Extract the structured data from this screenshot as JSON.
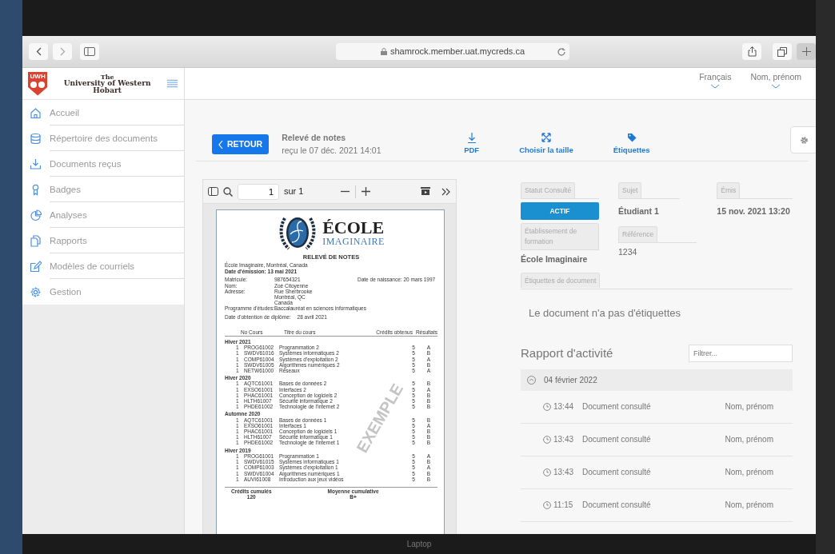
{
  "browser": {
    "url": "shamrock.member.uat.mycreds.ca"
  },
  "logo": {
    "badge": "UWH",
    "line_1": "The",
    "line_2": "University of Western Hobart"
  },
  "sidebar": {
    "items": [
      {
        "label": "Accueil"
      },
      {
        "label": "Répertoire des documents"
      },
      {
        "label": "Documents reçus"
      },
      {
        "label": "Badges"
      },
      {
        "label": "Analyses"
      },
      {
        "label": "Rapports"
      },
      {
        "label": "Modèles de courriels"
      },
      {
        "label": "Gestion"
      }
    ]
  },
  "header": {
    "language": "Français",
    "user": "Nom, prénom"
  },
  "toolbar": {
    "back": "RETOUR",
    "title": "Relevé de notes",
    "received": "reçu le 07 déc. 2021 14:01",
    "actions": [
      {
        "label": "PDF"
      },
      {
        "label": "Choisir la taille"
      },
      {
        "label": "Étiquettes"
      }
    ]
  },
  "viewer": {
    "page": "1",
    "page_total": "sur 1"
  },
  "document": {
    "school_1": "ÉCOLE",
    "school_2": "IMAGINAIRE",
    "title": "RELEVÉ DE NOTES",
    "place": "École Imaginaire, Montréal, Canada",
    "issued": "Date d'émission: 13 mai 2021",
    "info": [
      {
        "label": "Matricule:",
        "value": "987654321"
      },
      {
        "label": "Nom:",
        "value": "Zoé Citoyenne"
      },
      {
        "label": "Adresse:",
        "value": "Rue Sherbrooke"
      },
      {
        "value": "Montréal, QC"
      },
      {
        "value": "Canada"
      },
      {
        "label": "Programme d'études:",
        "value": "Baccalauréat en sciences informatiques"
      }
    ],
    "birth": "Date de naissance: 20 mars 1997",
    "graduation_label": "Date d'obtention de diplôme:",
    "graduation": "28 avril 2021",
    "columns": [
      "No Cours",
      "Titre du cours",
      "Crédits obtenus",
      "Résultats"
    ],
    "terms": [
      {
        "name": "Hiver 2021",
        "rows": [
          [
            "1",
            "PROG61002",
            "Programmation 2",
            "5",
            "A"
          ],
          [
            "1",
            "SWDV61016",
            "Systèmes informatiques 2",
            "5",
            "B"
          ],
          [
            "1",
            "COMP61004",
            "Systèmes d'exploitation 2",
            "5",
            "A"
          ],
          [
            "1",
            "SWDV61005",
            "Algorithmes numériques 2",
            "5",
            "B"
          ],
          [
            "1",
            "NETW61000",
            "Réseaux",
            "5",
            "A"
          ]
        ]
      },
      {
        "name": "Hiver 2020",
        "rows": [
          [
            "1",
            "AQTC61001",
            "Bases de données 2",
            "5",
            "B"
          ],
          [
            "1",
            "EXSO61001",
            "Interfaces 2",
            "5",
            "A"
          ],
          [
            "1",
            "PHAC61001",
            "Conception de logiciels 2",
            "5",
            "B"
          ],
          [
            "1",
            "HLTH61007",
            "Sécurité informatique 2",
            "5",
            "B"
          ],
          [
            "1",
            "PHDE61002",
            "Technologie de l'internet 2",
            "5",
            "B"
          ]
        ]
      },
      {
        "name": "Automne 2020",
        "rows": [
          [
            "1",
            "AQTC61001",
            "Bases de données 1",
            "5",
            "B"
          ],
          [
            "1",
            "EXSO61001",
            "Interfaces 1",
            "5",
            "A"
          ],
          [
            "1",
            "PHAC61001",
            "Conception de logiciels 1",
            "5",
            "B"
          ],
          [
            "1",
            "HLTH61007",
            "Sécurité informatique 1",
            "5",
            "B"
          ],
          [
            "1",
            "PHDE61002",
            "Technologie de l'internet 1",
            "5",
            "B"
          ]
        ]
      },
      {
        "name": "Hiver 2019",
        "rows": [
          [
            "1",
            "PROG61001",
            "Programmation 1",
            "5",
            "A"
          ],
          [
            "1",
            "SWDV61015",
            "Systèmes informatiques 1",
            "5",
            "B"
          ],
          [
            "1",
            "COMP61003",
            "Systèmes d'exploitation 1",
            "5",
            "A"
          ],
          [
            "1",
            "SWDV61004",
            "Algorithmes numériques 1",
            "5",
            "B"
          ],
          [
            "1",
            "AUVI61008",
            "Introduction aux jeux vidéos",
            "5",
            "B"
          ]
        ]
      }
    ],
    "credits_label": "Crédits cumulés",
    "credits": "120",
    "average_label": "Moyenne cumulative",
    "average": "B+",
    "watermark": "EXEMPLE"
  },
  "details": {
    "status": {
      "label": "Statut Consulté",
      "value": "ACTIF"
    },
    "subject": {
      "label": "Sujet",
      "value": "Étudiant 1"
    },
    "issued": {
      "label": "Émis",
      "value": "15 nov. 2021 13:20"
    },
    "institution": {
      "label": "Établissement de formation",
      "value": "École Imaginaire"
    },
    "reference": {
      "label": "Référence",
      "value": "1234"
    },
    "tags": {
      "label": "Étiquettes de document",
      "empty": "Le document n'a pas d'étiquettes"
    }
  },
  "activity": {
    "title": "Rapport d'activité",
    "filter": {
      "placeholder": "Filtrer..."
    },
    "groups": [
      {
        "date": "04 février 2022",
        "expanded": true,
        "entries": [
          {
            "time": "13:44",
            "action": "Document consulté",
            "user": "Nom, prénom"
          },
          {
            "time": "13:43",
            "action": "Document consulté",
            "user": "Nom, prénom"
          },
          {
            "time": "13:43",
            "action": "Document consulté",
            "user": "Nom, prénom"
          },
          {
            "time": "11:15",
            "action": "Document consulté",
            "user": "Nom, prénom"
          }
        ]
      }
    ]
  },
  "device": {
    "label": "Laptop"
  }
}
